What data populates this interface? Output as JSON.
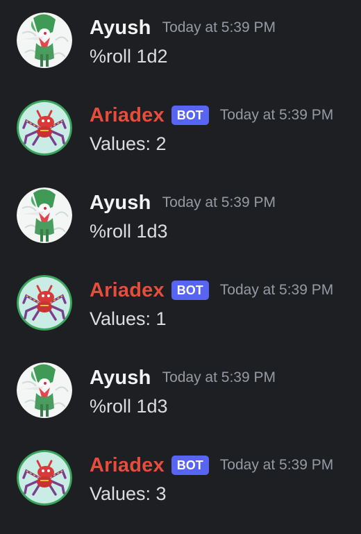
{
  "colors": {
    "background": "#1e1f22",
    "text": "#dbdee1",
    "muted": "#949ba4",
    "user_name": "#f2f3f5",
    "bot_name": "#e74c3c",
    "bot_tag": "#5865f2",
    "bot_avatar_ring": "#3ba55c"
  },
  "messages": [
    {
      "author": "Ayush",
      "is_bot": false,
      "timestamp": "Today at 5:39 PM",
      "content": "%roll 1d2",
      "avatar_icon": "gallade-avatar"
    },
    {
      "author": "Ariadex",
      "is_bot": true,
      "bot_tag": "BOT",
      "timestamp": "Today at 5:39 PM",
      "content": "Values: 2",
      "avatar_icon": "ariados-avatar"
    },
    {
      "author": "Ayush",
      "is_bot": false,
      "timestamp": "Today at 5:39 PM",
      "content": "%roll 1d3",
      "avatar_icon": "gallade-avatar"
    },
    {
      "author": "Ariadex",
      "is_bot": true,
      "bot_tag": "BOT",
      "timestamp": "Today at 5:39 PM",
      "content": "Values: 1",
      "avatar_icon": "ariados-avatar"
    },
    {
      "author": "Ayush",
      "is_bot": false,
      "timestamp": "Today at 5:39 PM",
      "content": "%roll 1d3",
      "avatar_icon": "gallade-avatar"
    },
    {
      "author": "Ariadex",
      "is_bot": true,
      "bot_tag": "BOT",
      "timestamp": "Today at 5:39 PM",
      "content": "Values: 3",
      "avatar_icon": "ariados-avatar"
    }
  ]
}
